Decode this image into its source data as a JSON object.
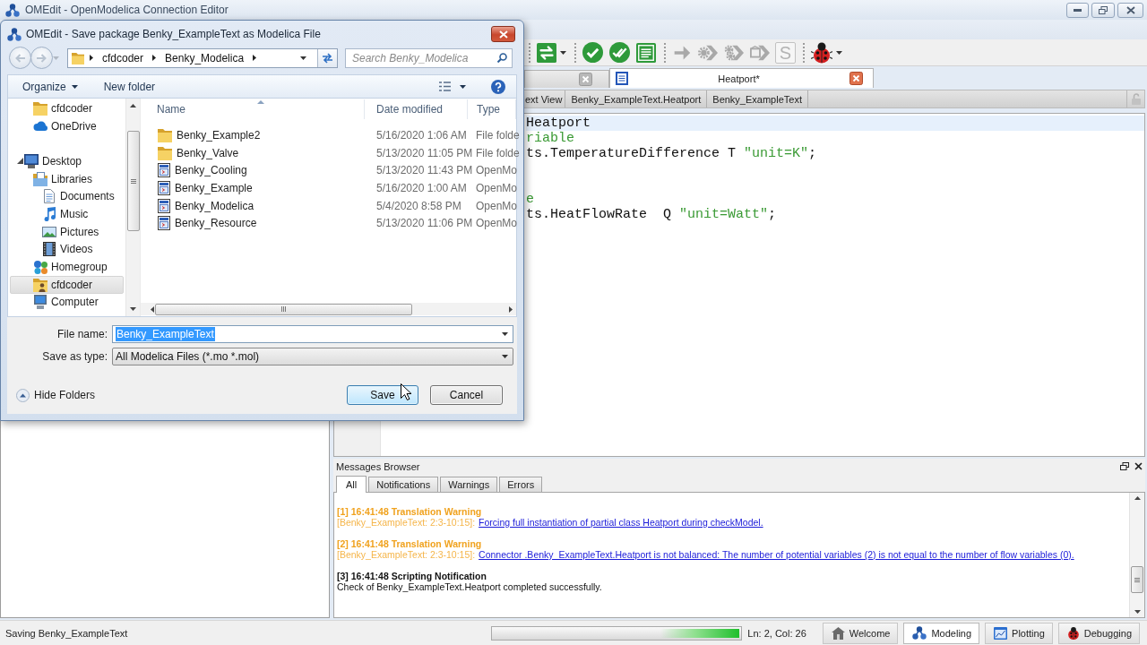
{
  "window": {
    "title": "OMEdit - OpenModelica Connection Editor"
  },
  "toolbar": {
    "groups": [
      [
        {
          "kind": "swap",
          "disabled": false,
          "menu": true
        }
      ],
      [
        {
          "kind": "check",
          "disabled": false
        },
        {
          "kind": "check-all",
          "disabled": false
        },
        {
          "kind": "instantiate",
          "disabled": false
        }
      ],
      [
        {
          "kind": "arrow",
          "disabled": true
        },
        {
          "kind": "gear-arrow",
          "disabled": true
        },
        {
          "kind": "gears-arrow",
          "disabled": true
        },
        {
          "kind": "box-arrow",
          "disabled": true
        },
        {
          "kind": "letter",
          "label": "S",
          "disabled": true
        }
      ],
      [
        {
          "kind": "ladybug",
          "disabled": false,
          "menu": true
        }
      ]
    ]
  },
  "editor_tabs": [
    {
      "selected": false
    },
    {
      "label": "Heatport*",
      "selected": true
    }
  ],
  "view_bar": [
    "ext View",
    "Benky_ExampleText.Heatport",
    "Benky_ExampleText"
  ],
  "code": [
    {
      "kind": "code",
      "highlighted": true,
      "segments": [
        {
          "kind": "plain",
          "text": "Heatport"
        }
      ]
    },
    {
      "kind": "code",
      "highlighted": false,
      "segments": [
        {
          "kind": "comment",
          "text": "riable"
        }
      ]
    },
    {
      "kind": "code",
      "highlighted": false,
      "segments": [
        {
          "kind": "plain",
          "text": "ts.TemperatureDifference T "
        },
        {
          "kind": "string",
          "text": "\"unit=K\""
        },
        {
          "kind": "plain",
          "text": ";"
        }
      ]
    },
    {
      "kind": "blank"
    },
    {
      "kind": "blank"
    },
    {
      "kind": "code",
      "highlighted": false,
      "segments": [
        {
          "kind": "comment",
          "text": "e"
        }
      ]
    },
    {
      "kind": "code",
      "highlighted": false,
      "segments": [
        {
          "kind": "plain",
          "text": "ts.HeatFlowRate  Q "
        },
        {
          "kind": "string",
          "text": "\"unit=Watt\""
        },
        {
          "kind": "plain",
          "text": ";"
        }
      ]
    }
  ],
  "messages_browser": {
    "title": "Messages Browser",
    "tabs": [
      {
        "label": "All",
        "selected": true
      },
      {
        "label": "Notifications",
        "selected": false
      },
      {
        "label": "Warnings",
        "selected": false
      },
      {
        "label": "Errors",
        "selected": false
      }
    ],
    "messages": [
      {
        "kind": "warning",
        "header": "[1] 16:41:48 Translation Warning",
        "location": "[Benky_ExampleText: 2:3-10:15]:",
        "text": "Forcing full instantiation of partial class Heatport during checkModel."
      },
      {
        "kind": "warning",
        "header": "[2] 16:41:48 Translation Warning",
        "location": "[Benky_ExampleText: 2:3-10:15]:",
        "text": "Connector .Benky_ExampleText.Heatport is not balanced: The number of potential variables (2) is not equal to the number of flow variables (0)."
      },
      {
        "kind": "notification",
        "header": "[3] 16:41:48 Scripting Notification",
        "text": "Check of Benky_ExampleText.Heatport completed successfully."
      }
    ]
  },
  "status_bar": {
    "message": "Saving Benky_ExampleText",
    "progress": {
      "level": 1
    },
    "position": "Ln: 2, Col: 26",
    "perspectives": [
      {
        "kind": "welcome",
        "label": "Welcome",
        "selected": false
      },
      {
        "kind": "modeling",
        "label": "Modeling",
        "selected": true
      },
      {
        "kind": "plotting",
        "label": "Plotting",
        "selected": false
      },
      {
        "kind": "debugging",
        "label": "Debugging",
        "selected": false
      }
    ]
  },
  "dialog": {
    "title": "OMEdit - Save package Benky_ExampleText as Modelica File",
    "address": [
      "cfdcoder",
      "Benky_Modelica"
    ],
    "search": {
      "placeholder": "Search Benky_Modelica"
    },
    "commands": [
      {
        "label": "Organize",
        "menu": true
      },
      {
        "label": "New folder"
      }
    ],
    "nav_favorites": [
      {
        "kind": "folder",
        "label": "cfdcoder",
        "selected": false
      },
      {
        "kind": "cloud",
        "label": "OneDrive",
        "selected": false
      }
    ],
    "nav_tree": [
      {
        "kind": "desktop",
        "label": "Desktop",
        "selected": false,
        "expanded": true,
        "children": [
          {
            "kind": "library",
            "label": "Libraries",
            "selected": false,
            "children": [
              {
                "kind": "document",
                "label": "Documents",
                "selected": false
              },
              {
                "kind": "music",
                "label": "Music",
                "selected": false
              },
              {
                "kind": "picture",
                "label": "Pictures",
                "selected": false
              },
              {
                "kind": "video",
                "label": "Videos",
                "selected": false
              }
            ]
          },
          {
            "kind": "homegroup",
            "label": "Homegroup",
            "selected": false
          },
          {
            "kind": "user",
            "label": "cfdcoder",
            "selected": true
          },
          {
            "kind": "computer",
            "label": "Computer",
            "selected": false
          }
        ]
      }
    ],
    "file_list": {
      "columns": [
        "Name",
        "Date modified",
        "Type"
      ],
      "rows": [
        {
          "kind": "folder",
          "name": "Benky_Example2",
          "date": "5/16/2020 1:06 AM",
          "type": "File folde"
        },
        {
          "kind": "folder",
          "name": "Benky_Valve",
          "date": "5/13/2020 11:05 PM",
          "type": "File folde"
        },
        {
          "kind": "modelica",
          "name": "Benky_Cooling",
          "date": "5/13/2020 11:43 PM",
          "type": "OpenMo"
        },
        {
          "kind": "modelica",
          "name": "Benky_Example",
          "date": "5/16/2020 1:00 AM",
          "type": "OpenMo"
        },
        {
          "kind": "modelica",
          "name": "Benky_Modelica",
          "date": "5/4/2020 8:58 PM",
          "type": "OpenMo"
        },
        {
          "kind": "modelica",
          "name": "Benky_Resource",
          "date": "5/13/2020 11:06 PM",
          "type": "OpenMo"
        }
      ]
    },
    "file_name": {
      "label": "File name:",
      "value": "Benky_ExampleText",
      "text_selected": true
    },
    "save_as_type": {
      "label": "Save as type:",
      "value": "All Modelica Files (*.mo *.mol)"
    },
    "hide_folders": "Hide Folders",
    "buttons": [
      {
        "kind": "default",
        "label": "Save"
      },
      {
        "kind": "normal",
        "label": "Cancel"
      }
    ]
  }
}
